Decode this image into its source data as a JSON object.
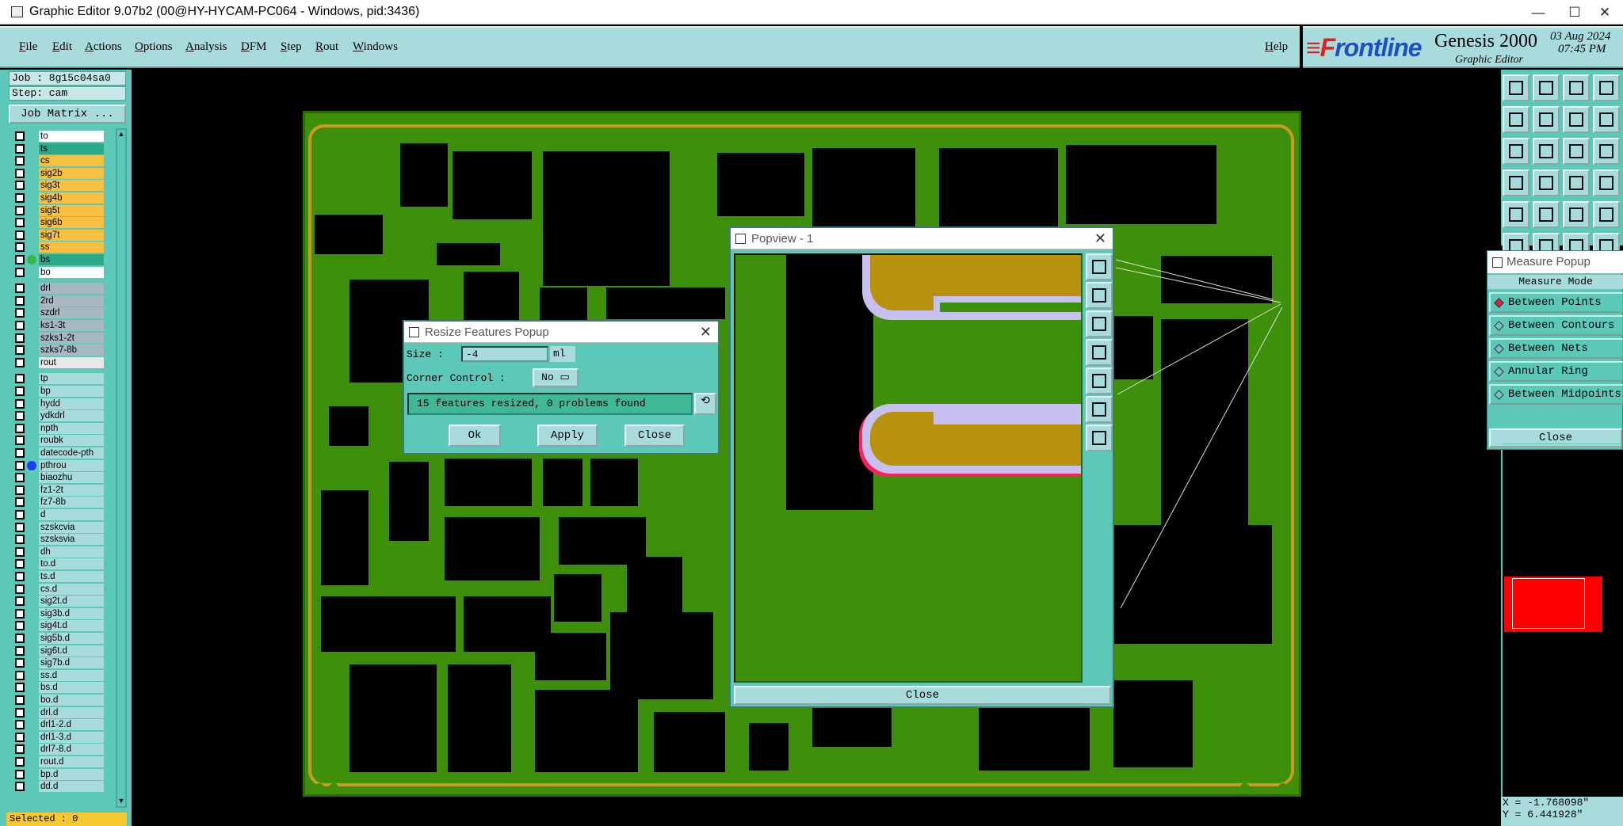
{
  "window": {
    "title": "Graphic Editor 9.07b2 (00@HY-HYCAM-PC064 - Windows, pid:3436)",
    "minimize": "—",
    "maximize": "☐",
    "close": "✕"
  },
  "menu": {
    "items": [
      "File",
      "Edit",
      "Actions",
      "Options",
      "Analysis",
      "DFM",
      "Step",
      "Rout",
      "Windows"
    ],
    "help": "Help"
  },
  "brand": {
    "logo_prefix": "F",
    "logo_rest": "rontline",
    "product": "Genesis 2000",
    "subtitle": "Graphic Editor",
    "date": "03 Aug 2024",
    "time": "07:45 PM"
  },
  "job": {
    "job_label": "Job : 8g15c04sa0",
    "step_label": "Step: cam",
    "matrix_button": "Job Matrix ..."
  },
  "layers": [
    {
      "name": "to",
      "color": "#ffffff",
      "dot": ""
    },
    {
      "name": "ts",
      "color": "#2aa888",
      "dot": ""
    },
    {
      "name": "cs",
      "color": "#f8c040",
      "dot": ""
    },
    {
      "name": "sig2b",
      "color": "#f8c040",
      "dot": ""
    },
    {
      "name": "sig3t",
      "color": "#f8c040",
      "dot": ""
    },
    {
      "name": "sig4b",
      "color": "#f8c040",
      "dot": ""
    },
    {
      "name": "sig5t",
      "color": "#f8c040",
      "dot": ""
    },
    {
      "name": "sig6b",
      "color": "#f8c040",
      "dot": ""
    },
    {
      "name": "sig7t",
      "color": "#f8c040",
      "dot": ""
    },
    {
      "name": "ss",
      "color": "#f8c040",
      "dot": ""
    },
    {
      "name": "bs",
      "color": "#2aa888",
      "dot": "#38b848"
    },
    {
      "name": "bo",
      "color": "#ffffff",
      "dot": ""
    },
    {
      "name": "",
      "color": "",
      "dot": "",
      "gap": true
    },
    {
      "name": "drl",
      "color": "#a8b8c0",
      "dot": ""
    },
    {
      "name": "2rd",
      "color": "#a8b8c0",
      "dot": ""
    },
    {
      "name": "szdrl",
      "color": "#a8b8c0",
      "dot": ""
    },
    {
      "name": "ks1-3t",
      "color": "#a8b8c0",
      "dot": ""
    },
    {
      "name": "szks1-2t",
      "color": "#a8b8c0",
      "dot": ""
    },
    {
      "name": "szks7-8b",
      "color": "#a8b8c0",
      "dot": ""
    },
    {
      "name": "rout",
      "color": "#e8e8e8",
      "dot": ""
    },
    {
      "name": "",
      "color": "",
      "dot": "",
      "gap": true
    },
    {
      "name": "tp",
      "color": "#a8dcdc",
      "dot": ""
    },
    {
      "name": "bp",
      "color": "#a8dcdc",
      "dot": ""
    },
    {
      "name": "hydd",
      "color": "#a8dcdc",
      "dot": ""
    },
    {
      "name": "ydkdrl",
      "color": "#a8dcdc",
      "dot": ""
    },
    {
      "name": "npth",
      "color": "#a8dcdc",
      "dot": ""
    },
    {
      "name": "roubk",
      "color": "#a8dcdc",
      "dot": ""
    },
    {
      "name": "datecode-pth",
      "color": "#a8dcdc",
      "dot": ""
    },
    {
      "name": "pthrou",
      "color": "#a8dcdc",
      "dot": "#2040f0"
    },
    {
      "name": "biaozhu",
      "color": "#a8dcdc",
      "dot": ""
    },
    {
      "name": "fz1-2t",
      "color": "#a8dcdc",
      "dot": ""
    },
    {
      "name": "fz7-8b",
      "color": "#a8dcdc",
      "dot": ""
    },
    {
      "name": "d",
      "color": "#a8dcdc",
      "dot": ""
    },
    {
      "name": "szskcvia",
      "color": "#a8dcdc",
      "dot": ""
    },
    {
      "name": "szsksvia",
      "color": "#a8dcdc",
      "dot": ""
    },
    {
      "name": "dh",
      "color": "#a8dcdc",
      "dot": ""
    },
    {
      "name": "to.d",
      "color": "#a8dcdc",
      "dot": ""
    },
    {
      "name": "ts.d",
      "color": "#a8dcdc",
      "dot": ""
    },
    {
      "name": "cs.d",
      "color": "#a8dcdc",
      "dot": ""
    },
    {
      "name": "sig2t.d",
      "color": "#a8dcdc",
      "dot": ""
    },
    {
      "name": "sig3b.d",
      "color": "#a8dcdc",
      "dot": ""
    },
    {
      "name": "sig4t.d",
      "color": "#a8dcdc",
      "dot": ""
    },
    {
      "name": "sig5b.d",
      "color": "#a8dcdc",
      "dot": ""
    },
    {
      "name": "sig6t.d",
      "color": "#a8dcdc",
      "dot": ""
    },
    {
      "name": "sig7b.d",
      "color": "#a8dcdc",
      "dot": ""
    },
    {
      "name": "ss.d",
      "color": "#a8dcdc",
      "dot": ""
    },
    {
      "name": "bs.d",
      "color": "#a8dcdc",
      "dot": ""
    },
    {
      "name": "bo.d",
      "color": "#a8dcdc",
      "dot": ""
    },
    {
      "name": "drl.d",
      "color": "#a8dcdc",
      "dot": ""
    },
    {
      "name": "drl1-2.d",
      "color": "#a8dcdc",
      "dot": ""
    },
    {
      "name": "drl1-3.d",
      "color": "#a8dcdc",
      "dot": ""
    },
    {
      "name": "drl7-8.d",
      "color": "#a8dcdc",
      "dot": ""
    },
    {
      "name": "rout.d",
      "color": "#a8dcdc",
      "dot": ""
    },
    {
      "name": "bp.d",
      "color": "#a8dcdc",
      "dot": ""
    },
    {
      "name": "dd.d",
      "color": "#a8dcdc",
      "dot": ""
    }
  ],
  "selected": "Selected : 0",
  "resize_popup": {
    "title": "Resize Features Popup",
    "size_label": "Size :",
    "size_value": "-4",
    "size_unit": "ml",
    "corner_label": "Corner Control :",
    "corner_value": "No",
    "status": "15 features resized, 0 problems found",
    "ok": "Ok",
    "apply": "Apply",
    "close": "Close"
  },
  "popview": {
    "title": "Popview - 1",
    "close": "Close"
  },
  "measure": {
    "title": "Measure Popup",
    "mode_label": "Measure Mode",
    "options": [
      "Between Points",
      "Between Contours",
      "Between Nets",
      "Annular Ring",
      "Between Midpoints"
    ],
    "close": "Close"
  },
  "coords": {
    "x": "X = -1.768098\"",
    "y": "Y =  6.441928\""
  },
  "colors": {
    "panel": "#5cc8b8",
    "board_green": "#3e8f0a",
    "copper": "#c89a28",
    "mask": "#c8c0f0",
    "highlight": "#ff2060"
  }
}
